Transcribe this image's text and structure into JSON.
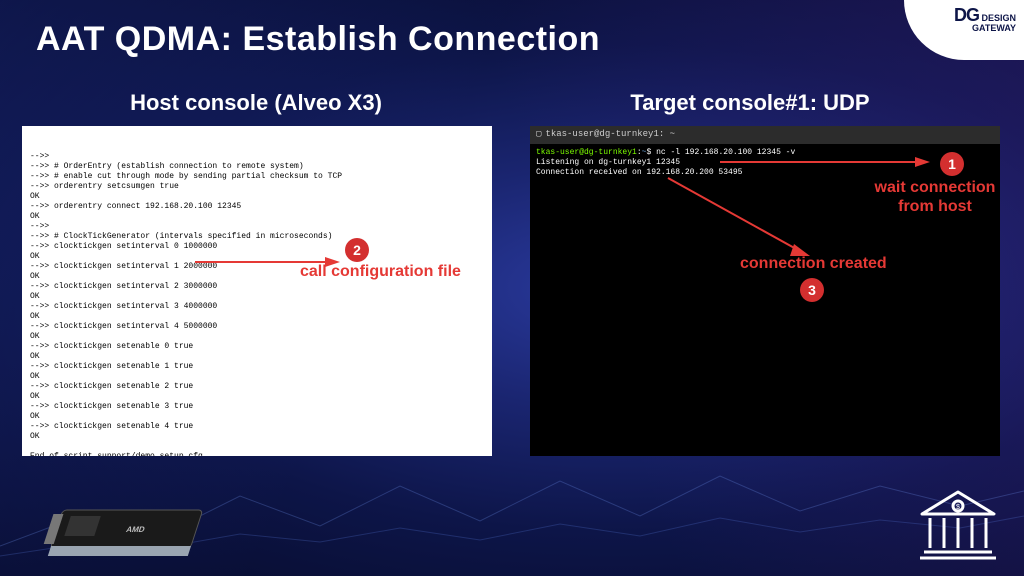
{
  "branding": {
    "logo_prefix": "DG",
    "logo_line1": "DESIGN",
    "logo_line2": "GATEWAY"
  },
  "title": "AAT QDMA: Establish Connection",
  "panels": {
    "host": {
      "subtitle": "Host console (Alveo X3)",
      "lines": [
        "-->>",
        "-->> # OrderEntry (establish connection to remote system)",
        "-->> # enable cut through mode by sending partial checksum to TCP",
        "-->> orderentry setcsumgen true",
        "OK",
        "-->> orderentry connect 192.168.20.100 12345",
        "OK",
        "-->>",
        "-->> # ClockTickGenerator (intervals specified in microseconds)",
        "-->> clocktickgen setinterval 0 1000000",
        "OK",
        "-->> clocktickgen setinterval 1 2000000",
        "OK",
        "-->> clocktickgen setinterval 2 3000000",
        "OK",
        "-->> clocktickgen setinterval 3 4000000",
        "OK",
        "-->> clocktickgen setinterval 4 5000000",
        "OK",
        "-->> clocktickgen setenable 0 true",
        "OK",
        "-->> clocktickgen setenable 1 true",
        "OK",
        "-->> clocktickgen setenable 2 true",
        "OK",
        "-->> clocktickgen setenable 3 true",
        "OK",
        "-->> clocktickgen setenable 4 true",
        "OK",
        "",
        "End of script support/demo_setup.cfg",
        "",
        ">>"
      ]
    },
    "target": {
      "subtitle": "Target console#1: UDP",
      "window_title": "tkas-user@dg-turnkey1: ~",
      "prompt_user": "tkas-user@dg-turnkey1",
      "prompt_path": "~",
      "command": "nc -l 192.168.20.100 12345 -v",
      "out1": "Listening on dg-turnkey1 12345",
      "out2": "Connection received on 192.168.20.200 53495"
    }
  },
  "callouts": {
    "n1": "1",
    "n2": "2",
    "n3": "3",
    "label_wait": "wait connection\nfrom host",
    "label_conn": "connection created",
    "label_cfg": "call configuration file"
  }
}
